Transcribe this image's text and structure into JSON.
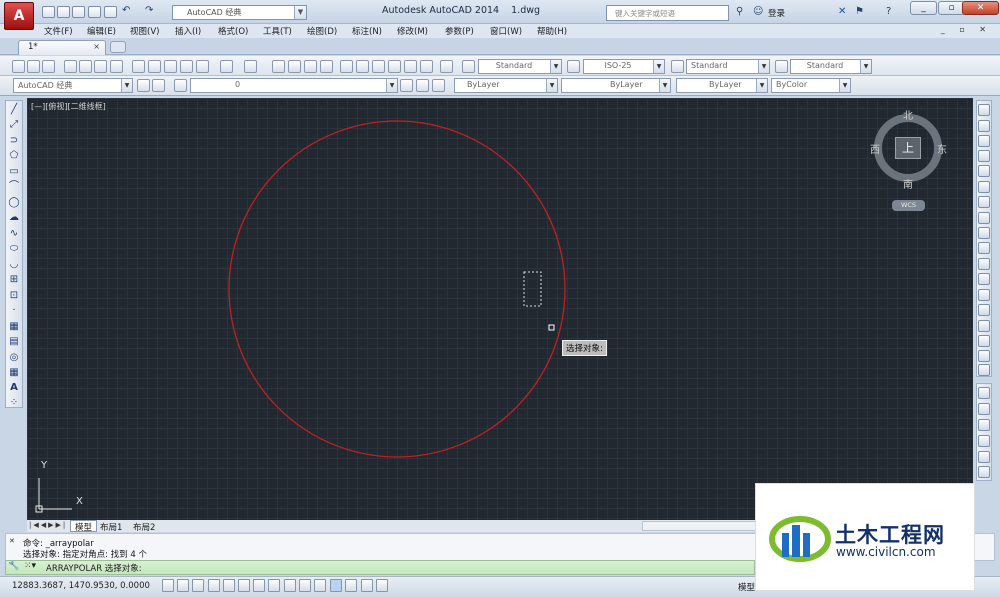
{
  "title_bar": {
    "app_logo": "A",
    "workspace": "AutoCAD 经典",
    "title": "Autodesk AutoCAD 2014    1.dwg",
    "search_placeholder": "键入关键字或短语",
    "login": "登录"
  },
  "menu": [
    "文件(F)",
    "编辑(E)",
    "视图(V)",
    "插入(I)",
    "格式(O)",
    "工具(T)",
    "绘图(D)",
    "标注(N)",
    "修改(M)",
    "参数(P)",
    "窗口(W)",
    "帮助(H)"
  ],
  "tab": {
    "label": "1*",
    "close": "×"
  },
  "styles_toolbar": {
    "text_style": "Standard",
    "dim_style": "ISO-25",
    "table_style": "Standard",
    "multileader_style": "Standard"
  },
  "layers_toolbar": {
    "workspace": "AutoCAD 经典",
    "layer": "0",
    "color": "ByLayer",
    "linetype": "ByLayer",
    "lineweight": "ByLayer",
    "plotstyle": "ByColor"
  },
  "viewport": {
    "label": "[—][俯视][二维线框]",
    "tooltip": "选择对象:",
    "viewcube": {
      "north": "北",
      "south": "南",
      "east": "东",
      "west": "西",
      "top": "上",
      "wcs": "WCS"
    },
    "ucs": {
      "x": "X",
      "y": "Y"
    }
  },
  "layout_tabs": [
    "模型",
    "布局1",
    "布局2"
  ],
  "command": {
    "history": [
      "命令: _arraypolar",
      "选择对象: 指定对角点: 找到 4 个"
    ],
    "prompt": "ARRAYPOLAR 选择对象:"
  },
  "status": {
    "coordinates": "12883.3687, 1470.9530, 0.0000",
    "model": "模型"
  },
  "watermark": {
    "title": "土木工程网",
    "url": "www.civilcn.com"
  },
  "colors": {
    "circle": "#c02020",
    "drawing_bg": "#212830"
  }
}
